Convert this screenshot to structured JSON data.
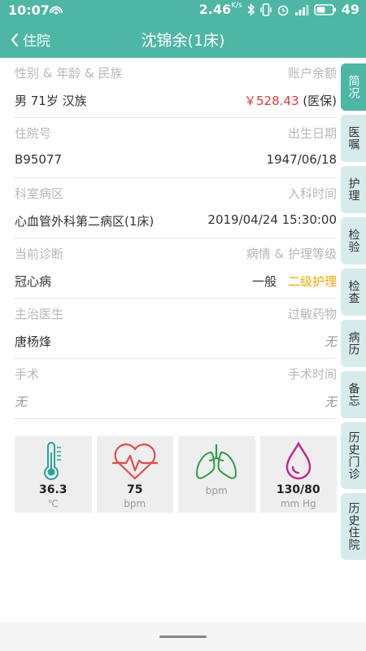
{
  "status": {
    "time": "10:07",
    "speed": "2.46",
    "speed_unit": "K/s",
    "battery": "49"
  },
  "header": {
    "back_label": "住院",
    "title": "沈锦余(1床)"
  },
  "info": {
    "row1": {
      "left_label": "性别 & 年龄 & 民族",
      "right_label": "账户余额",
      "left_value": "男 71岁 汉族",
      "balance": "￥528.43",
      "insurance": "(医保)"
    },
    "row2": {
      "left_label": "住院号",
      "right_label": "出生日期",
      "left_value": "B95077",
      "right_value": "1947/06/18"
    },
    "row3": {
      "left_label": "科室病区",
      "right_label": "入科时间",
      "left_value": "心血管外科第二病区(1床)",
      "right_value": "2019/04/24 15:30:00"
    },
    "row4": {
      "left_label": "当前诊断",
      "right_label": "病情 & 护理等级",
      "left_value": "冠心病",
      "condition": "一般",
      "nursing_level": "二级护理"
    },
    "row5": {
      "left_label": "主治医生",
      "right_label": "过敏药物",
      "left_value": "唐杨烽",
      "right_value": "无"
    },
    "row6": {
      "left_label": "手术",
      "right_label": "手术时间",
      "left_value": "无",
      "right_value": "无"
    }
  },
  "vitals": {
    "temperature": {
      "value": "36.3",
      "unit": "℃"
    },
    "heart_rate": {
      "value": "75",
      "unit": "bpm"
    },
    "respiration": {
      "unit": "bpm"
    },
    "blood_pressure": {
      "value": "130/80",
      "unit": "mm Hg"
    }
  },
  "tabs": [
    "简况",
    "医嘱",
    "护理",
    "检验",
    "检查",
    "病历",
    "备忘",
    "历史门诊",
    "历史住院"
  ],
  "colors": {
    "primary": "#4db6a4",
    "tab_bg": "#d6ecea",
    "balance_red": "#e53935",
    "nursing_orange": "#f0a800"
  }
}
